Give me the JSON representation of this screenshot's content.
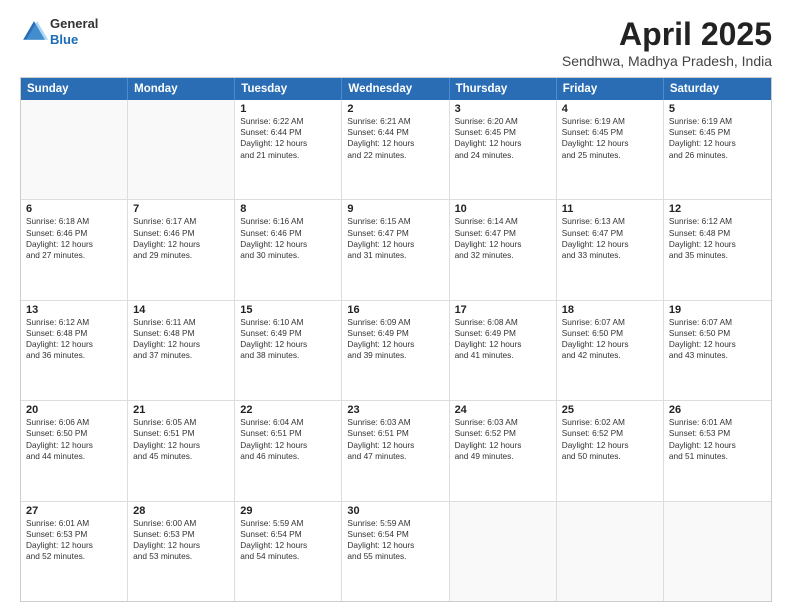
{
  "logo": {
    "general": "General",
    "blue": "Blue"
  },
  "header": {
    "month": "April 2025",
    "location": "Sendhwa, Madhya Pradesh, India"
  },
  "weekdays": [
    "Sunday",
    "Monday",
    "Tuesday",
    "Wednesday",
    "Thursday",
    "Friday",
    "Saturday"
  ],
  "rows": [
    [
      {
        "day": "",
        "empty": true
      },
      {
        "day": "",
        "empty": true
      },
      {
        "day": "1",
        "lines": [
          "Sunrise: 6:22 AM",
          "Sunset: 6:44 PM",
          "Daylight: 12 hours",
          "and 21 minutes."
        ]
      },
      {
        "day": "2",
        "lines": [
          "Sunrise: 6:21 AM",
          "Sunset: 6:44 PM",
          "Daylight: 12 hours",
          "and 22 minutes."
        ]
      },
      {
        "day": "3",
        "lines": [
          "Sunrise: 6:20 AM",
          "Sunset: 6:45 PM",
          "Daylight: 12 hours",
          "and 24 minutes."
        ]
      },
      {
        "day": "4",
        "lines": [
          "Sunrise: 6:19 AM",
          "Sunset: 6:45 PM",
          "Daylight: 12 hours",
          "and 25 minutes."
        ]
      },
      {
        "day": "5",
        "lines": [
          "Sunrise: 6:19 AM",
          "Sunset: 6:45 PM",
          "Daylight: 12 hours",
          "and 26 minutes."
        ]
      }
    ],
    [
      {
        "day": "6",
        "lines": [
          "Sunrise: 6:18 AM",
          "Sunset: 6:46 PM",
          "Daylight: 12 hours",
          "and 27 minutes."
        ]
      },
      {
        "day": "7",
        "lines": [
          "Sunrise: 6:17 AM",
          "Sunset: 6:46 PM",
          "Daylight: 12 hours",
          "and 29 minutes."
        ]
      },
      {
        "day": "8",
        "lines": [
          "Sunrise: 6:16 AM",
          "Sunset: 6:46 PM",
          "Daylight: 12 hours",
          "and 30 minutes."
        ]
      },
      {
        "day": "9",
        "lines": [
          "Sunrise: 6:15 AM",
          "Sunset: 6:47 PM",
          "Daylight: 12 hours",
          "and 31 minutes."
        ]
      },
      {
        "day": "10",
        "lines": [
          "Sunrise: 6:14 AM",
          "Sunset: 6:47 PM",
          "Daylight: 12 hours",
          "and 32 minutes."
        ]
      },
      {
        "day": "11",
        "lines": [
          "Sunrise: 6:13 AM",
          "Sunset: 6:47 PM",
          "Daylight: 12 hours",
          "and 33 minutes."
        ]
      },
      {
        "day": "12",
        "lines": [
          "Sunrise: 6:12 AM",
          "Sunset: 6:48 PM",
          "Daylight: 12 hours",
          "and 35 minutes."
        ]
      }
    ],
    [
      {
        "day": "13",
        "lines": [
          "Sunrise: 6:12 AM",
          "Sunset: 6:48 PM",
          "Daylight: 12 hours",
          "and 36 minutes."
        ]
      },
      {
        "day": "14",
        "lines": [
          "Sunrise: 6:11 AM",
          "Sunset: 6:48 PM",
          "Daylight: 12 hours",
          "and 37 minutes."
        ]
      },
      {
        "day": "15",
        "lines": [
          "Sunrise: 6:10 AM",
          "Sunset: 6:49 PM",
          "Daylight: 12 hours",
          "and 38 minutes."
        ]
      },
      {
        "day": "16",
        "lines": [
          "Sunrise: 6:09 AM",
          "Sunset: 6:49 PM",
          "Daylight: 12 hours",
          "and 39 minutes."
        ]
      },
      {
        "day": "17",
        "lines": [
          "Sunrise: 6:08 AM",
          "Sunset: 6:49 PM",
          "Daylight: 12 hours",
          "and 41 minutes."
        ]
      },
      {
        "day": "18",
        "lines": [
          "Sunrise: 6:07 AM",
          "Sunset: 6:50 PM",
          "Daylight: 12 hours",
          "and 42 minutes."
        ]
      },
      {
        "day": "19",
        "lines": [
          "Sunrise: 6:07 AM",
          "Sunset: 6:50 PM",
          "Daylight: 12 hours",
          "and 43 minutes."
        ]
      }
    ],
    [
      {
        "day": "20",
        "lines": [
          "Sunrise: 6:06 AM",
          "Sunset: 6:50 PM",
          "Daylight: 12 hours",
          "and 44 minutes."
        ]
      },
      {
        "day": "21",
        "lines": [
          "Sunrise: 6:05 AM",
          "Sunset: 6:51 PM",
          "Daylight: 12 hours",
          "and 45 minutes."
        ]
      },
      {
        "day": "22",
        "lines": [
          "Sunrise: 6:04 AM",
          "Sunset: 6:51 PM",
          "Daylight: 12 hours",
          "and 46 minutes."
        ]
      },
      {
        "day": "23",
        "lines": [
          "Sunrise: 6:03 AM",
          "Sunset: 6:51 PM",
          "Daylight: 12 hours",
          "and 47 minutes."
        ]
      },
      {
        "day": "24",
        "lines": [
          "Sunrise: 6:03 AM",
          "Sunset: 6:52 PM",
          "Daylight: 12 hours",
          "and 49 minutes."
        ]
      },
      {
        "day": "25",
        "lines": [
          "Sunrise: 6:02 AM",
          "Sunset: 6:52 PM",
          "Daylight: 12 hours",
          "and 50 minutes."
        ]
      },
      {
        "day": "26",
        "lines": [
          "Sunrise: 6:01 AM",
          "Sunset: 6:53 PM",
          "Daylight: 12 hours",
          "and 51 minutes."
        ]
      }
    ],
    [
      {
        "day": "27",
        "lines": [
          "Sunrise: 6:01 AM",
          "Sunset: 6:53 PM",
          "Daylight: 12 hours",
          "and 52 minutes."
        ]
      },
      {
        "day": "28",
        "lines": [
          "Sunrise: 6:00 AM",
          "Sunset: 6:53 PM",
          "Daylight: 12 hours",
          "and 53 minutes."
        ]
      },
      {
        "day": "29",
        "lines": [
          "Sunrise: 5:59 AM",
          "Sunset: 6:54 PM",
          "Daylight: 12 hours",
          "and 54 minutes."
        ]
      },
      {
        "day": "30",
        "lines": [
          "Sunrise: 5:59 AM",
          "Sunset: 6:54 PM",
          "Daylight: 12 hours",
          "and 55 minutes."
        ]
      },
      {
        "day": "",
        "empty": true
      },
      {
        "day": "",
        "empty": true
      },
      {
        "day": "",
        "empty": true
      }
    ]
  ]
}
